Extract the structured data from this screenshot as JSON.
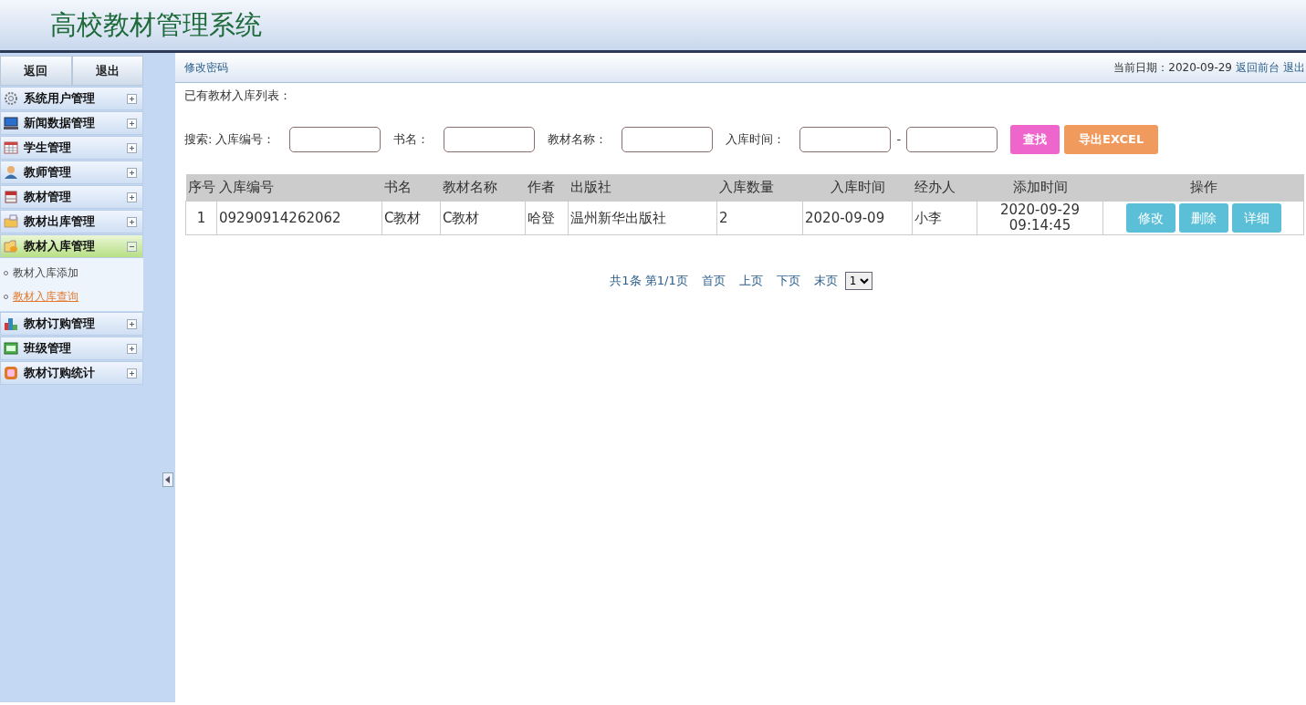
{
  "header": {
    "title": "高校教材管理系统"
  },
  "sidebar": {
    "top_buttons": [
      "返回",
      "退出"
    ],
    "items": [
      {
        "label": "系统用户管理",
        "expanded": false
      },
      {
        "label": "新闻数据管理",
        "expanded": false
      },
      {
        "label": "学生管理",
        "expanded": false
      },
      {
        "label": "教师管理",
        "expanded": false
      },
      {
        "label": "教材管理",
        "expanded": false
      },
      {
        "label": "教材出库管理",
        "expanded": false
      },
      {
        "label": "教材入库管理",
        "expanded": true,
        "children": [
          {
            "label": "教材入库添加",
            "selected": false
          },
          {
            "label": "教材入库查询",
            "selected": true
          }
        ]
      },
      {
        "label": "教材订购管理",
        "expanded": false
      },
      {
        "label": "班级管理",
        "expanded": false
      },
      {
        "label": "教材订购统计",
        "expanded": false
      }
    ]
  },
  "topbar": {
    "left_link": "修改密码",
    "date_label": "当前日期：2020-09-29",
    "links": [
      "返回前台",
      "退出"
    ]
  },
  "list_title": "已有教材入库列表：",
  "search": {
    "prefix": "搜索:",
    "fields": [
      {
        "label": "入库编号："
      },
      {
        "label": "书名："
      },
      {
        "label": "教材名称："
      },
      {
        "label": "入库时间："
      }
    ],
    "range_sep": "-",
    "buttons": [
      {
        "label": "查找",
        "kind": "search"
      },
      {
        "label": "导出EXCEL",
        "kind": "export"
      }
    ]
  },
  "table": {
    "columns": [
      "序号",
      "入库编号",
      "书名",
      "教材名称",
      "作者",
      "出版社",
      "入库数量",
      "入库时间",
      "经办人",
      "添加时间",
      "操作"
    ],
    "rows": [
      {
        "cells": [
          "1",
          "09290914262062",
          "C教材",
          "C教材",
          "哈登",
          "温州新华出版社",
          "2",
          "2020-09-09",
          "小李",
          "2020-09-29 09:14:45"
        ],
        "actions": [
          "修改",
          "删除",
          "详细"
        ]
      }
    ]
  },
  "pagination": {
    "summary": "共1条 第1/1页",
    "links": [
      "首页",
      "上页",
      "下页",
      "末页"
    ],
    "page_select": "1"
  }
}
